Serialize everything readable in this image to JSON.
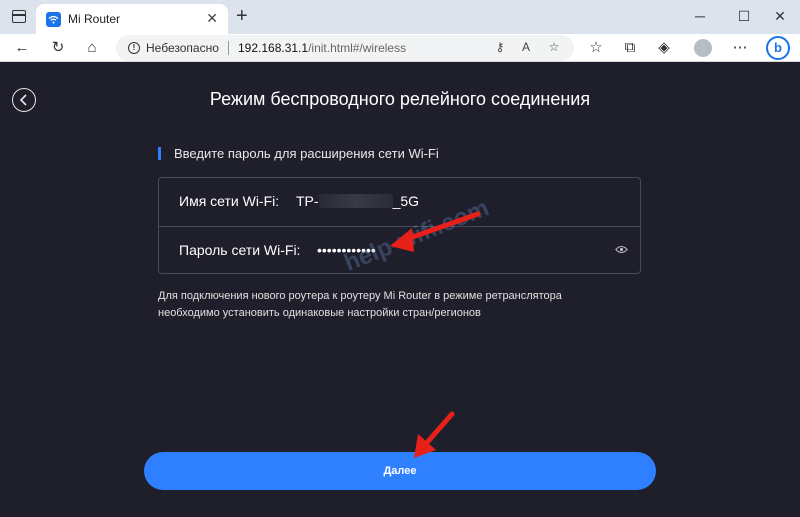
{
  "browser": {
    "tab_title": "Mi Router",
    "tab_close": "✕",
    "new_tab": "+",
    "security_label": "Небезопасно",
    "url_host": "192.168.31.1",
    "url_path": "/init.html#/wireless",
    "window_controls": [
      "─",
      "☐",
      "✕"
    ]
  },
  "page": {
    "title": "Режим беспроводного релейного соединения",
    "subtitle": "Введите пароль для расширения сети Wi-Fi",
    "network_name_label": "Имя сети Wi-Fi:",
    "network_name_prefix": "TP-",
    "network_name_suffix": "_5G",
    "password_label": "Пароль сети Wi-Fi:",
    "password_masked": "••••••••••••",
    "note": "Для подключения нового роутера к роутеру Mi Router в режиме ретранслятора необходимо установить одинаковые настройки стран/регионов",
    "next_button": "Далее",
    "watermark": "help-wifi.com"
  },
  "colors": {
    "page_background": "#1f1f2b",
    "accent": "#2f80ff",
    "annotation_arrow": "#e8201a"
  },
  "icons": [
    "window-icon",
    "wifi-favicon",
    "back-arrow-icon",
    "refresh-icon",
    "home-icon",
    "warning-icon",
    "key-icon",
    "read-aloud-icon",
    "favorite-add-icon",
    "favorites-icon",
    "collections-icon",
    "edge-shield-icon",
    "profile-icon",
    "more-icon",
    "bing-icon",
    "back-circle-icon",
    "eye-icon"
  ]
}
